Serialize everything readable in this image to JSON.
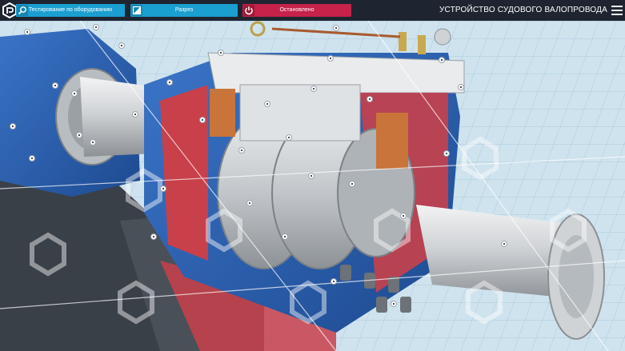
{
  "app": {
    "title": "УСТРОЙСТВО СУДОВОГО ВАЛОПРОВОДА"
  },
  "toolbar": {
    "test_label": "Тестирование по оборудованию",
    "cut_label": "Разрез",
    "stop_label": "Остановлено",
    "test_icon": "search-icon",
    "cut_icon": "cut-section-icon",
    "stop_icon": "power-icon",
    "colors": {
      "blue_button": "#1a9fd0",
      "red_button": "#c6224a",
      "bar": "#1e2530"
    }
  },
  "scene": {
    "colors": {
      "housing_blue": "#2a5fb0",
      "housing_red": "#c8404a",
      "metal": "#c8ccd0",
      "floor_grid": "#cfe3ee",
      "frame_dark": "#3a4048"
    },
    "hotspot_count": 33
  }
}
